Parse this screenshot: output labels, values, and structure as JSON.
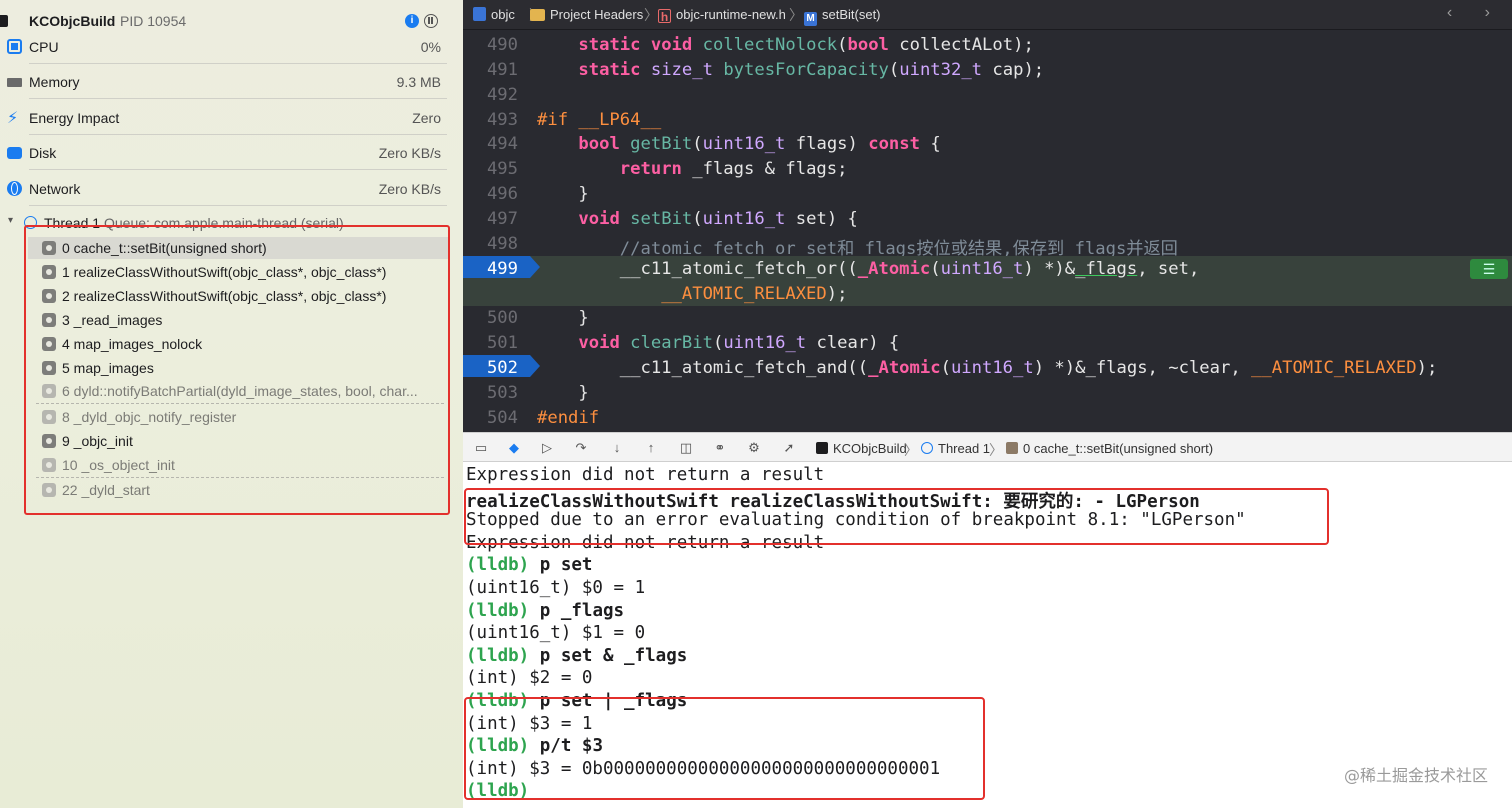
{
  "navigator": {
    "process_name": "KCObjcBuild",
    "pid": "PID 10954",
    "gauges": [
      {
        "label": "CPU",
        "value": "0%",
        "icon": "cpu-icon"
      },
      {
        "label": "Memory",
        "value": "9.3 MB",
        "icon": "memory-icon"
      },
      {
        "label": "Energy Impact",
        "value": "Zero",
        "icon": "energy-icon"
      },
      {
        "label": "Disk",
        "value": "Zero KB/s",
        "icon": "disk-icon"
      },
      {
        "label": "Network",
        "value": "Zero KB/s",
        "icon": "network-icon"
      }
    ],
    "thread": {
      "label": "Thread 1",
      "queue": "Queue: com.apple.main-thread (serial)"
    },
    "frames": [
      {
        "label": "0 cache_t::setBit(unsigned short)",
        "selected": true,
        "dim": false
      },
      {
        "label": "1 realizeClassWithoutSwift(objc_class*, objc_class*)",
        "dim": false
      },
      {
        "label": "2 realizeClassWithoutSwift(objc_class*, objc_class*)",
        "dim": false
      },
      {
        "label": "3 _read_images",
        "dim": false
      },
      {
        "label": "4 map_images_nolock",
        "dim": false
      },
      {
        "label": "5 map_images",
        "dim": false
      },
      {
        "label": "6 dyld::notifyBatchPartial(dyld_image_states, bool, char...",
        "dim": true
      },
      {
        "label": "8 _dyld_objc_notify_register",
        "dim": true
      },
      {
        "label": "9 _objc_init",
        "dim": false
      },
      {
        "label": "10 _os_object_init",
        "dim": true
      },
      {
        "label": "22 _dyld_start",
        "dim": true
      }
    ]
  },
  "jumpbar": {
    "crumbs": [
      "objc",
      "Project Headers",
      "objc-runtime-new.h",
      "setBit(set)"
    ],
    "h_glyph": "h",
    "m_glyph": "M"
  },
  "editor": {
    "lines": [
      {
        "n": "490",
        "html": "    <span class=\"k-kw\">static</span> <span class=\"k-kw\">void</span> <span class=\"k-fn\">collectNolock</span>(<span class=\"k-kw\">bool</span> collectALot);"
      },
      {
        "n": "491",
        "html": "    <span class=\"k-kw\">static</span> <span class=\"k-ty\">size_t</span> <span class=\"k-fn\">bytesForCapacity</span>(<span class=\"k-ty\">uint32_t</span> cap);"
      },
      {
        "n": "492",
        "html": ""
      },
      {
        "n": "493",
        "html": "<span class=\"k-pp\">#if __LP64__</span>"
      },
      {
        "n": "494",
        "html": "    <span class=\"k-kw\">bool</span> <span class=\"k-fn\">getBit</span>(<span class=\"k-ty\">uint16_t</span> flags) <span class=\"k-kw\">const</span> {"
      },
      {
        "n": "495",
        "html": "        <span class=\"k-kw\">return</span> _flags &amp; flags;"
      },
      {
        "n": "496",
        "html": "    }"
      },
      {
        "n": "497",
        "html": "    <span class=\"k-kw\">void</span> <span class=\"k-fn\">setBit</span>(<span class=\"k-ty\">uint16_t</span> set) {"
      },
      {
        "n": "498",
        "html": "        <span class=\"k-cm\">//atomic_fetch_or set和_flags按位或结果,保存到_flags并返回</span>"
      },
      {
        "n": "499",
        "html": "        __c11_atomic_fetch_or((<span class=\"k-kw\">_Atomic</span>(<span class=\"k-ty\">uint16_t</span>) *)&amp;<span class=\"k-ul\">_flags</span>, set,",
        "bp": true,
        "current": true
      },
      {
        "n": "",
        "html": "            <span class=\"k-pp\">__ATOMIC_RELAXED</span>);",
        "current": true
      },
      {
        "n": "500",
        "html": "    }"
      },
      {
        "n": "501",
        "html": "    <span class=\"k-kw\">void</span> <span class=\"k-fn\">clearBit</span>(<span class=\"k-ty\">uint16_t</span> clear) {"
      },
      {
        "n": "502",
        "html": "        __c11_atomic_fetch_and((<span class=\"k-kw\">_Atomic</span>(<span class=\"k-ty\">uint16_t</span>) *)&amp;_flags, ~clear, <span class=\"k-pp\">__ATOMIC_RELAXED</span>);",
        "bp": true
      },
      {
        "n": "503",
        "html": "    }"
      },
      {
        "n": "504",
        "html": "<span class=\"k-pp\">#endif</span>"
      }
    ],
    "menu_glyph": "☰"
  },
  "debugbar": {
    "crumbs": [
      "KCObjcBuild",
      "Thread 1",
      "0 cache_t::setBit(unsigned short)"
    ]
  },
  "console": {
    "lines": [
      {
        "t": "Expression did not return a result"
      },
      {
        "t": "realizeClassWithoutSwift realizeClassWithoutSwift: 要研究的: - LGPerson",
        "bold": true
      },
      {
        "t": "Stopped due to an error evaluating condition of breakpoint 8.1: \"LGPerson\""
      },
      {
        "t": "Expression did not return a result"
      },
      {
        "prompt": "(lldb)",
        "cmd": "p set"
      },
      {
        "t": "(uint16_t) $0 = 1"
      },
      {
        "prompt": "(lldb)",
        "cmd": "p _flags"
      },
      {
        "t": "(uint16_t) $1 = 0"
      },
      {
        "prompt": "(lldb)",
        "cmd": "p set & _flags"
      },
      {
        "t": "(int) $2 = 0"
      },
      {
        "prompt": "(lldb)",
        "cmd": "p set | _flags"
      },
      {
        "t": "(int) $3 = 1"
      },
      {
        "prompt": "(lldb)",
        "cmd": "p/t $3"
      },
      {
        "t": "(int) $3 = 0b00000000000000000000000000000001"
      },
      {
        "prompt": "(lldb)",
        "cmd": ""
      }
    ],
    "watermark": "@稀土掘金技术社区"
  }
}
